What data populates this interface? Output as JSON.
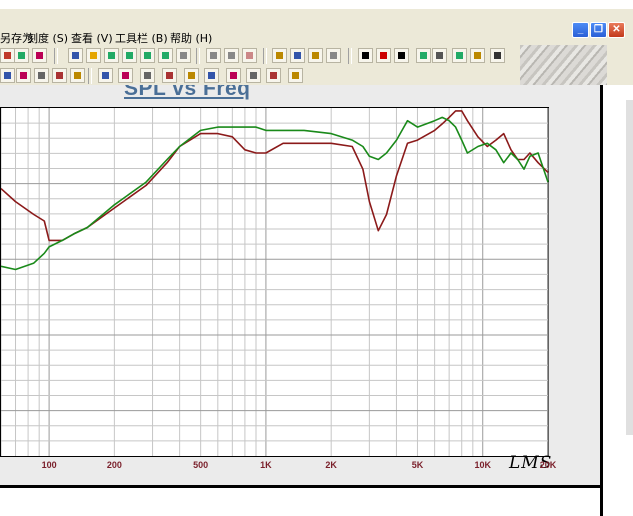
{
  "menu": [
    "另存为",
    "刻度 (S)",
    "查看 (V)",
    "工具栏 (B)",
    "帮助 (H)"
  ],
  "window_buttons": [
    "_",
    "❐",
    "✕"
  ],
  "chart": {
    "title": "SPL vs Freq",
    "watermark": "LMS"
  },
  "chart_data": {
    "type": "line",
    "title": "SPL vs Freq",
    "x_scale": "log",
    "xlim": [
      60,
      20000
    ],
    "ylim": [
      0,
      100
    ],
    "x_tick_labels": [
      "100",
      "200",
      "500",
      "1K",
      "2K",
      "5K",
      "10K",
      "20K"
    ],
    "x_ticks": [
      100,
      200,
      500,
      1000,
      2000,
      5000,
      10000,
      20000
    ],
    "grid": true,
    "series": [
      {
        "color": "#8b1a1a",
        "x": [
          60,
          70,
          85,
          95,
          100,
          115,
          130,
          150,
          200,
          280,
          350,
          400,
          500,
          600,
          700,
          800,
          900,
          1000,
          1200,
          1500,
          2000,
          2500,
          2800,
          3000,
          3300,
          3600,
          4000,
          4500,
          5000,
          6000,
          6500,
          7000,
          7500,
          8000,
          8500,
          9500,
          10500,
          11500,
          12500,
          13500,
          14500,
          15500,
          16500,
          18000,
          20000
        ],
        "y": [
          82,
          78,
          74,
          72,
          66,
          66,
          68,
          70,
          76,
          83,
          90,
          95,
          99,
          99,
          98,
          94,
          93,
          93,
          96,
          96,
          96,
          95,
          88,
          78,
          69,
          74,
          86,
          96,
          97,
          100,
          102,
          104,
          106,
          106,
          103,
          98,
          95,
          97,
          99,
          94,
          91,
          91,
          93,
          90,
          87
        ],
        "label_color_name": "dark red"
      },
      {
        "color": "#1a8a1a",
        "x": [
          60,
          70,
          85,
          95,
          100,
          115,
          130,
          150,
          200,
          280,
          350,
          400,
          500,
          600,
          700,
          800,
          900,
          1000,
          1200,
          1500,
          2000,
          2500,
          2800,
          3000,
          3300,
          3600,
          4000,
          4500,
          5000,
          6000,
          6500,
          7000,
          7500,
          8000,
          8500,
          9500,
          10500,
          11500,
          12500,
          13500,
          14500,
          15500,
          16500,
          18000,
          20000
        ],
        "y": [
          58,
          57,
          59,
          62,
          64,
          66,
          68,
          70,
          77,
          84,
          91,
          95,
          100,
          101,
          101,
          101,
          101,
          100,
          100,
          100,
          99,
          97,
          95,
          92,
          91,
          93,
          97,
          103,
          101,
          103,
          104,
          103,
          101,
          97,
          93,
          95,
          96,
          94,
          90,
          93,
          91,
          88,
          92,
          93,
          84
        ],
        "label_color_name": "green"
      }
    ]
  }
}
